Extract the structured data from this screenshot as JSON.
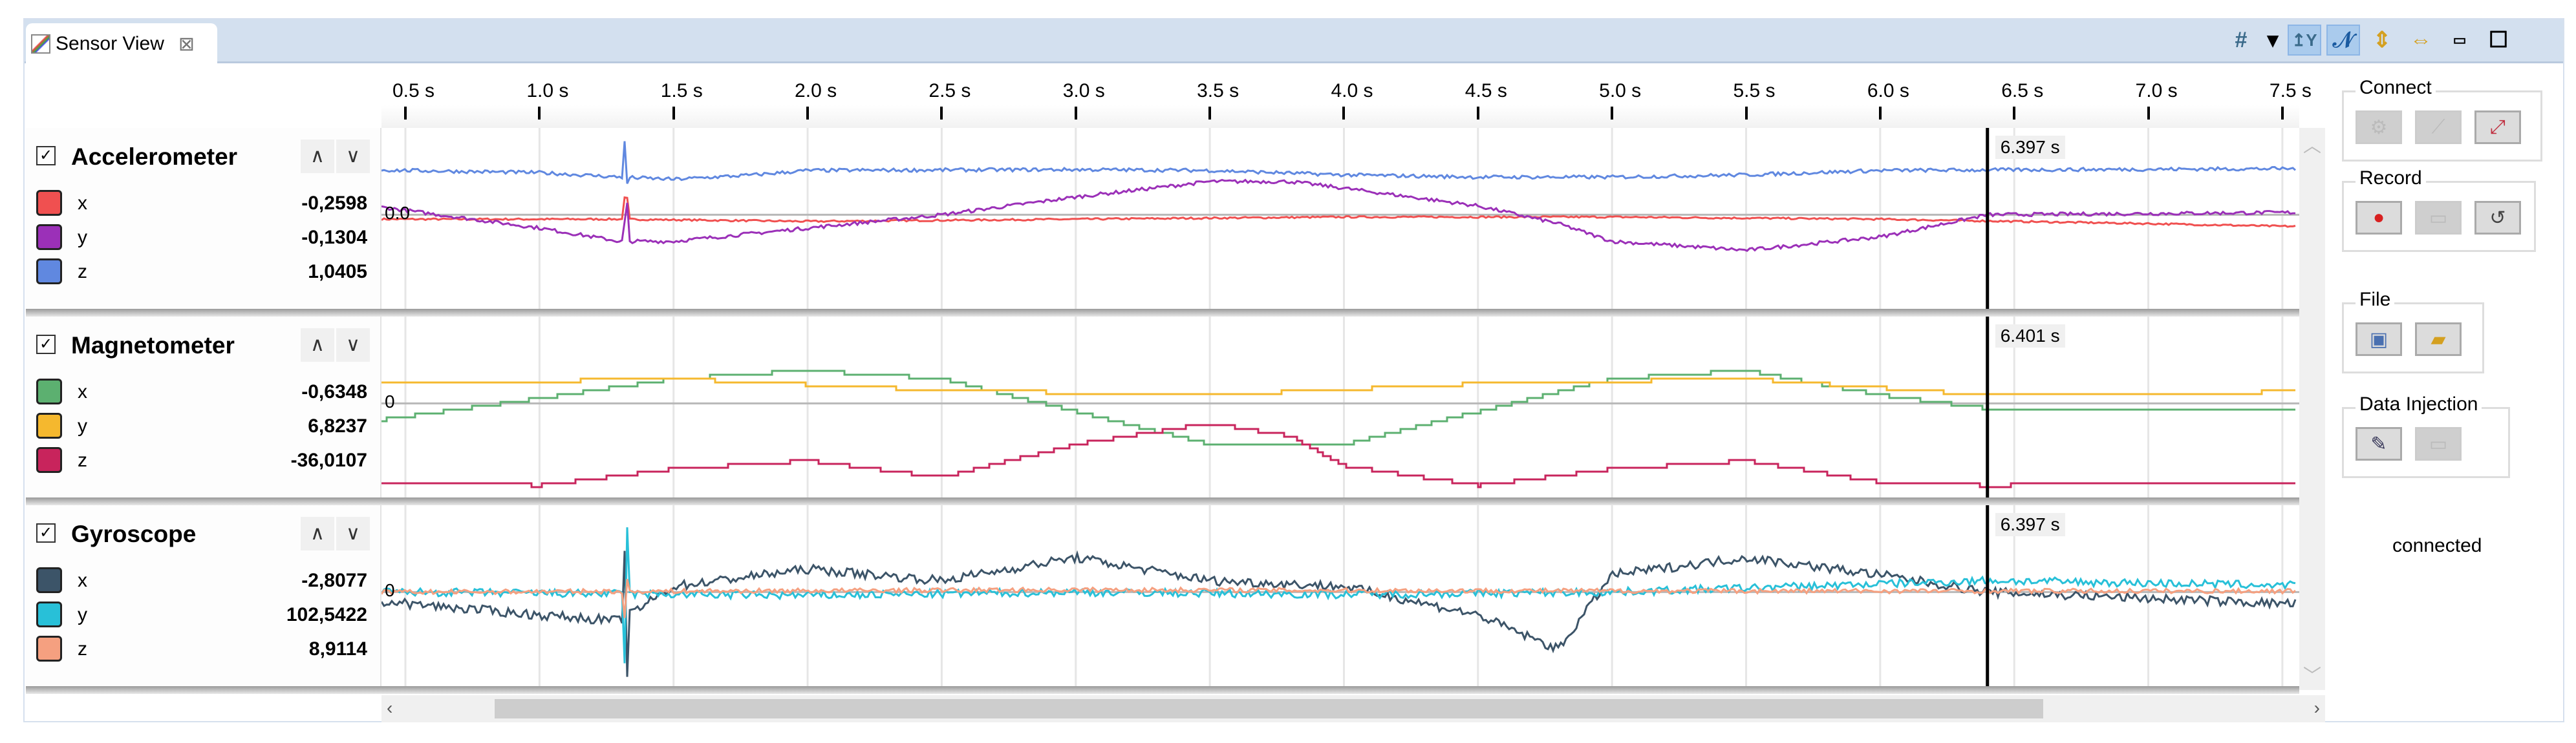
{
  "tab": {
    "title": "Sensor View",
    "icon": "chart-icon",
    "close": "⊠"
  },
  "toolbar": {
    "grid": "#",
    "dropdown": "▾",
    "autoscale_y": "↥Y",
    "line_mode": "𝒩",
    "fit_vertical": "⇕",
    "fit_horizontal": "⇔",
    "minimize": "▭",
    "maximize": "☐"
  },
  "axis": {
    "ticks": [
      "0.5 s",
      "1.0 s",
      "1.5 s",
      "2.0 s",
      "2.5 s",
      "3.0 s",
      "3.5 s",
      "4.0 s",
      "4.5 s",
      "5.0 s",
      "5.5 s",
      "6.0 s",
      "6.5 s",
      "7.0 s",
      "7.5 s"
    ],
    "tick_values": [
      0.5,
      1.0,
      1.5,
      2.0,
      2.5,
      3.0,
      3.5,
      4.0,
      4.5,
      5.0,
      5.5,
      6.0,
      6.5,
      7.0,
      7.5
    ],
    "cursor_time": 6.4
  },
  "sensors": [
    {
      "title": "Accelerometer",
      "checked": "✓",
      "up": "∧",
      "down": "∨",
      "zero_label": "0.0",
      "cursor_label": "6.397 s",
      "scale": 27,
      "channels": [
        {
          "name": "x",
          "value": "-0,2598",
          "color": "#f05050",
          "noise": 0.02,
          "points": [
            [
              0.5,
              -0.1
            ],
            [
              1.3,
              -0.1
            ],
            [
              2,
              -0.15
            ],
            [
              3,
              -0.1
            ],
            [
              4,
              -0.05
            ],
            [
              5,
              -0.05
            ],
            [
              6,
              -0.1
            ],
            [
              7,
              -0.2
            ],
            [
              7.5,
              -0.26
            ]
          ]
        },
        {
          "name": "y",
          "value": "-0,1304",
          "color": "#9b30b8",
          "noise": 0.04,
          "points": [
            [
              0.5,
              0.1
            ],
            [
              1.0,
              -0.3
            ],
            [
              1.3,
              -0.6
            ],
            [
              1.5,
              -0.6
            ],
            [
              2.0,
              -0.3
            ],
            [
              2.5,
              0
            ],
            [
              3.0,
              0.4
            ],
            [
              3.5,
              0.75
            ],
            [
              3.8,
              0.75
            ],
            [
              4.0,
              0.6
            ],
            [
              4.5,
              0.2
            ],
            [
              4.8,
              -0.2
            ],
            [
              5.0,
              -0.6
            ],
            [
              5.5,
              -0.8
            ],
            [
              6.0,
              -0.5
            ],
            [
              6.4,
              0
            ],
            [
              7.5,
              0.05
            ]
          ]
        },
        {
          "name": "z",
          "value": "1,0405",
          "color": "#6088e0",
          "noise": 0.04,
          "points": [
            [
              0.5,
              1.0
            ],
            [
              1.0,
              0.95
            ],
            [
              1.3,
              0.85
            ],
            [
              1.5,
              0.8
            ],
            [
              1.8,
              0.9
            ],
            [
              2.0,
              1.0
            ],
            [
              3.0,
              1.02
            ],
            [
              3.5,
              1.0
            ],
            [
              4.0,
              0.9
            ],
            [
              4.5,
              0.85
            ],
            [
              5.0,
              0.85
            ],
            [
              5.5,
              0.9
            ],
            [
              6.0,
              1.0
            ],
            [
              7.5,
              1.04
            ]
          ]
        }
      ]
    },
    {
      "title": "Magnetometer",
      "checked": "✓",
      "up": "∧",
      "down": "∨",
      "zero_label": "0",
      "cursor_label": "6.401 s",
      "scale": 1,
      "channels": [
        {
          "name": "x",
          "value": "-0,6348",
          "color": "#5cb070",
          "noise": 0,
          "points": [
            [
              0.5,
              -8
            ],
            [
              1.0,
              3
            ],
            [
              1.5,
              15
            ],
            [
              2.0,
              20
            ],
            [
              2.5,
              15
            ],
            [
              3.0,
              -5
            ],
            [
              3.5,
              -25
            ],
            [
              4.0,
              -25
            ],
            [
              4.5,
              -5
            ],
            [
              5.0,
              15
            ],
            [
              5.5,
              20
            ],
            [
              6.0,
              5
            ],
            [
              6.4,
              -3
            ],
            [
              7.5,
              -3
            ]
          ]
        },
        {
          "name": "y",
          "value": "6,8237",
          "color": "#f5b82e",
          "noise": 0,
          "points": [
            [
              0.5,
              12
            ],
            [
              1.5,
              15
            ],
            [
              2.5,
              8
            ],
            [
              3.5,
              5
            ],
            [
              4.5,
              12
            ],
            [
              5.5,
              15
            ],
            [
              6.4,
              5
            ],
            [
              7.5,
              7
            ]
          ]
        },
        {
          "name": "z",
          "value": "-36,0107",
          "color": "#c8245c",
          "noise": 0,
          "points": [
            [
              0.5,
              -48
            ],
            [
              1.0,
              -50
            ],
            [
              1.5,
              -40
            ],
            [
              2.0,
              -35
            ],
            [
              2.5,
              -45
            ],
            [
              3.0,
              -25
            ],
            [
              3.5,
              -12
            ],
            [
              3.8,
              -20
            ],
            [
              4.0,
              -38
            ],
            [
              4.5,
              -50
            ],
            [
              5.0,
              -40
            ],
            [
              5.5,
              -35
            ],
            [
              6.0,
              -48
            ],
            [
              6.4,
              -50
            ],
            [
              7.5,
              -48
            ]
          ]
        }
      ]
    },
    {
      "title": "Gyroscope",
      "checked": "✓",
      "up": "∧",
      "down": "∨",
      "zero_label": "0",
      "cursor_label": "6.397 s",
      "scale": 0.07,
      "channels": [
        {
          "name": "x",
          "value": "-2,8077",
          "color": "#3c5468",
          "noise": 40,
          "points": [
            [
              0.5,
              -100
            ],
            [
              1.0,
              -200
            ],
            [
              1.3,
              -250
            ],
            [
              1.5,
              50
            ],
            [
              2.0,
              200
            ],
            [
              2.5,
              100
            ],
            [
              3.0,
              300
            ],
            [
              3.5,
              100
            ],
            [
              4.0,
              50
            ],
            [
              4.5,
              -200
            ],
            [
              4.8,
              -500
            ],
            [
              5.0,
              150
            ],
            [
              5.5,
              300
            ],
            [
              6.0,
              150
            ],
            [
              6.4,
              0
            ],
            [
              7.5,
              -100
            ]
          ]
        },
        {
          "name": "y",
          "value": "102,5422",
          "color": "#28c0d8",
          "noise": 35,
          "points": [
            [
              0.5,
              0
            ],
            [
              2,
              -30
            ],
            [
              3,
              0
            ],
            [
              4,
              -20
            ],
            [
              5,
              0
            ],
            [
              6.4,
              100
            ],
            [
              7.5,
              60
            ]
          ]
        },
        {
          "name": "z",
          "value": "8,9114",
          "color": "#f5a080",
          "noise": 20,
          "points": [
            [
              0.5,
              0
            ],
            [
              3,
              20
            ],
            [
              5,
              10
            ],
            [
              7.5,
              9
            ]
          ]
        }
      ]
    }
  ],
  "side": {
    "connect": {
      "label": "Connect",
      "buttons": [
        "settings-icon",
        "disconnect-icon",
        "connect-icon"
      ]
    },
    "record": {
      "label": "Record",
      "buttons": [
        "record-icon",
        "stop-icon",
        "reset-icon"
      ]
    },
    "file": {
      "label": "File",
      "buttons": [
        "save-icon",
        "open-folder-icon"
      ]
    },
    "injection": {
      "label": "Data Injection",
      "buttons": [
        "inject-icon",
        "stop-injection-icon"
      ]
    },
    "status": "connected"
  }
}
